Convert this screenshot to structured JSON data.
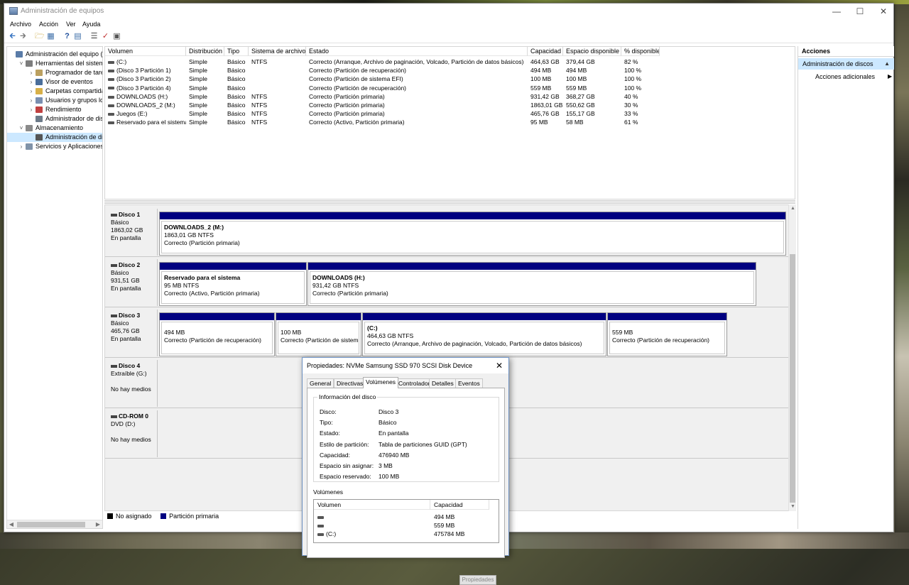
{
  "window": {
    "title": "Administración de equipos"
  },
  "menu": [
    "Archivo",
    "Acción",
    "Ver",
    "Ayuda"
  ],
  "tree": {
    "items": [
      {
        "label": "Administración del equipo (loc",
        "level": 0,
        "arrow": "",
        "icon": "computer-icon"
      },
      {
        "label": "Herramientas del sistema",
        "level": 1,
        "arrow": "˅",
        "icon": "tools-icon"
      },
      {
        "label": "Programador de tareas",
        "level": 2,
        "arrow": "›",
        "icon": "clock-icon"
      },
      {
        "label": "Visor de eventos",
        "level": 2,
        "arrow": "›",
        "icon": "event-viewer-icon"
      },
      {
        "label": "Carpetas compartidas",
        "level": 2,
        "arrow": "›",
        "icon": "shared-folder-icon"
      },
      {
        "label": "Usuarios y grupos locale",
        "level": 2,
        "arrow": "›",
        "icon": "users-icon"
      },
      {
        "label": "Rendimiento",
        "level": 2,
        "arrow": "›",
        "icon": "performance-icon"
      },
      {
        "label": "Administrador de dispo",
        "level": 2,
        "arrow": "",
        "icon": "device-manager-icon"
      },
      {
        "label": "Almacenamiento",
        "level": 1,
        "arrow": "˅",
        "icon": "storage-icon"
      },
      {
        "label": "Administración de disco",
        "level": 2,
        "arrow": "",
        "icon": "disk-icon",
        "selected": true
      },
      {
        "label": "Servicios y Aplicaciones",
        "level": 1,
        "arrow": "›",
        "icon": "services-icon"
      }
    ]
  },
  "volumes": {
    "headers": [
      "Volumen",
      "Distribución",
      "Tipo",
      "Sistema de archivos",
      "Estado",
      "Capacidad",
      "Espacio disponible",
      "% disponible"
    ],
    "rows": [
      [
        "(C:)",
        "Simple",
        "Básico",
        "NTFS",
        "Correcto (Arranque, Archivo de paginación, Volcado, Partición de datos básicos)",
        "464,63 GB",
        "379,44 GB",
        "82 %"
      ],
      [
        "(Disco 3 Partición 1)",
        "Simple",
        "Básico",
        "",
        "Correcto (Partición de recuperación)",
        "494 MB",
        "494 MB",
        "100 %"
      ],
      [
        "(Disco 3 Partición 2)",
        "Simple",
        "Básico",
        "",
        "Correcto (Partición de sistema EFI)",
        "100 MB",
        "100 MB",
        "100 %"
      ],
      [
        "(Disco 3 Partición 4)",
        "Simple",
        "Básico",
        "",
        "Correcto (Partición de recuperación)",
        "559 MB",
        "559 MB",
        "100 %"
      ],
      [
        "DOWNLOADS (H:)",
        "Simple",
        "Básico",
        "NTFS",
        "Correcto (Partición primaria)",
        "931,42 GB",
        "368,27 GB",
        "40 %"
      ],
      [
        "DOWNLOADS_2 (M:)",
        "Simple",
        "Básico",
        "NTFS",
        "Correcto (Partición primaria)",
        "1863,01 GB",
        "550,62 GB",
        "30 %"
      ],
      [
        "Juegos (E:)",
        "Simple",
        "Básico",
        "NTFS",
        "Correcto (Partición primaria)",
        "465,76 GB",
        "155,17 GB",
        "33 %"
      ],
      [
        "Reservado para el sistema",
        "Simple",
        "Básico",
        "NTFS",
        "Correcto (Activo, Partición primaria)",
        "95 MB",
        "58 MB",
        "61 %"
      ]
    ]
  },
  "disks": [
    {
      "name": "Disco 1",
      "lines": [
        "Básico",
        "1863,02 GB",
        "En pantalla"
      ],
      "partitions": [
        {
          "title": "DOWNLOADS_2  (M:)",
          "size": "1863,01 GB NTFS",
          "status": "Correcto (Partición primaria)"
        }
      ]
    },
    {
      "name": "Disco 2",
      "lines": [
        "Básico",
        "931,51 GB",
        "En pantalla"
      ],
      "partitions": [
        {
          "title": "Reservado para el sistema",
          "size": "95 MB NTFS",
          "status": "Correcto (Activo, Partición primaria)"
        },
        {
          "title": "DOWNLOADS  (H:)",
          "size": "931,42 GB NTFS",
          "status": "Correcto (Partición primaria)"
        }
      ]
    },
    {
      "name": "Disco 3",
      "lines": [
        "Básico",
        "465,76 GB",
        "En pantalla"
      ],
      "partitions": [
        {
          "title": "",
          "size": "494 MB",
          "status": "Correcto (Partición de recuperación)"
        },
        {
          "title": "",
          "size": "100 MB",
          "status": "Correcto (Partición de sistem"
        },
        {
          "title": "(C:)",
          "size": "464,63 GB NTFS",
          "status": "Correcto (Arranque, Archivo de paginación, Volcado, Partición de datos básicos)"
        },
        {
          "title": "",
          "size": "559 MB",
          "status": "Correcto (Partición de recuperación)"
        }
      ]
    },
    {
      "name": "Disco 4",
      "lines": [
        "Extraíble (G:)",
        "",
        "No hay medios"
      ],
      "partitions": []
    },
    {
      "name": "CD-ROM 0",
      "lines": [
        "DVD (D:)",
        "",
        "No hay medios"
      ],
      "partitions": []
    }
  ],
  "legend": {
    "unassigned": "No asignado",
    "primary": "Partición primaria",
    "unassigned_color": "#000000",
    "primary_color": "#000080"
  },
  "actions": {
    "header": "Acciones",
    "section": "Administración de discos",
    "item": "Acciones adicionales"
  },
  "dialog": {
    "title": "Propiedades: NVMe Samsung SSD 970 SCSI Disk Device",
    "tabs": [
      "General",
      "Directivas",
      "Volúmenes",
      "Controlador",
      "Detalles",
      "Eventos"
    ],
    "active_tab": "Volúmenes",
    "group_title": "Información del disco",
    "fields": [
      {
        "k": "Disco:",
        "v": "Disco 3"
      },
      {
        "k": "Tipo:",
        "v": "Básico"
      },
      {
        "k": "Estado:",
        "v": "En pantalla"
      },
      {
        "k": "Estilo de partición:",
        "v": "Tabla de particiones GUID (GPT)"
      },
      {
        "k": "Capacidad:",
        "v": "476940 MB"
      },
      {
        "k": "Espacio sin asignar:",
        "v": "3 MB"
      },
      {
        "k": "Espacio reservado:",
        "v": "100 MB"
      }
    ],
    "volumes_label": "Volúmenes",
    "vol_headers": [
      "Volumen",
      "Capacidad"
    ],
    "vol_rows": [
      [
        "",
        "494 MB"
      ],
      [
        "",
        "559 MB"
      ],
      [
        "(C:)",
        "475784 MB"
      ]
    ],
    "button": "Propiedades"
  }
}
